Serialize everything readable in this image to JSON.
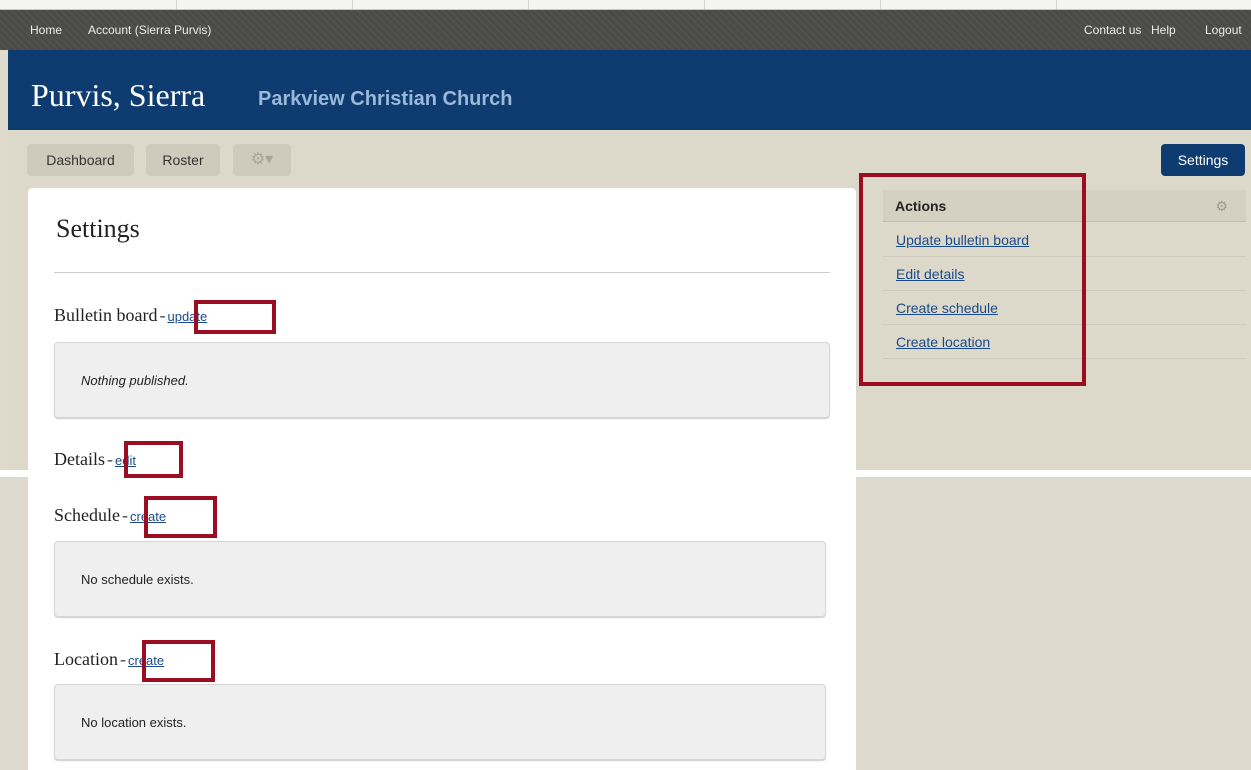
{
  "topnav": {
    "home": "Home",
    "account": "Account (Sierra Purvis)",
    "contact": "Contact us",
    "help": "Help",
    "logout": "Logout"
  },
  "banner": {
    "name": "Purvis, Sierra",
    "org": "Parkview Christian Church"
  },
  "subnav": {
    "dashboard": "Dashboard",
    "roster": "Roster",
    "gear": "⚙▾",
    "settings": "Settings"
  },
  "main": {
    "title": "Settings",
    "bulletin": {
      "heading": "Bulletin board",
      "link": "update",
      "message": "Nothing published."
    },
    "details": {
      "heading": "Details",
      "link": "edit"
    },
    "schedule": {
      "heading": "Schedule",
      "link": "create",
      "message": "No schedule exists."
    },
    "location": {
      "heading": "Location",
      "link": "create",
      "message": "No location exists."
    }
  },
  "actions": {
    "title": "Actions",
    "gear": "⚙",
    "items": [
      "Update bulletin board",
      "Edit details",
      "Create schedule",
      "Create location"
    ]
  },
  "colors": {
    "banner": "#0e3c70",
    "highlight": "#9a0d22",
    "link": "#1a4a8a"
  }
}
